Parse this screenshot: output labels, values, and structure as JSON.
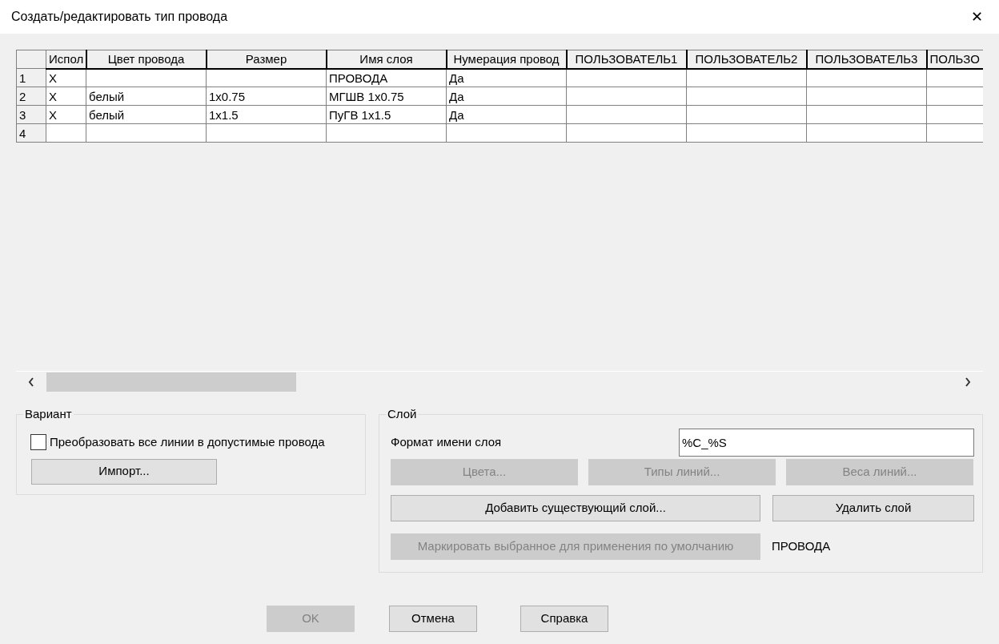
{
  "window": {
    "title": "Создать/редактировать тип провода",
    "close": "✕"
  },
  "table": {
    "columns": [
      "Испол",
      "Цвет провода",
      "Размер",
      "Имя слоя",
      "Нумерация провод",
      "ПОЛЬЗОВАТЕЛЬ1",
      "ПОЛЬЗОВАТЕЛЬ2",
      "ПОЛЬЗОВАТЕЛЬ3",
      "ПОЛЬЗО"
    ],
    "rows": [
      {
        "number": "1",
        "cells": [
          "X",
          "",
          "",
          "ПРОВОДА",
          "Да",
          "",
          "",
          "",
          ""
        ]
      },
      {
        "number": "2",
        "cells": [
          "X",
          "белый",
          "1x0.75",
          "МГШВ 1x0.75",
          "Да",
          "",
          "",
          "",
          ""
        ]
      },
      {
        "number": "3",
        "cells": [
          "X",
          "белый",
          "1x1.5",
          "ПуГВ 1x1.5",
          "Да",
          "",
          "",
          "",
          ""
        ]
      },
      {
        "number": "4",
        "cells": [
          "",
          "",
          "",
          "",
          "",
          "",
          "",
          "",
          ""
        ]
      }
    ]
  },
  "variant": {
    "title": "Вариант",
    "checkbox": {
      "label": "Преобразовать все линии в допустимые провода",
      "checked": false
    },
    "import_button": {
      "label": "Импорт...",
      "disabled": false
    }
  },
  "layer": {
    "title": "Слой",
    "format_label": "Формат имени слоя",
    "format_value": "%C_%S",
    "buttons_row1": [
      {
        "label": "Цвета...",
        "disabled": true
      },
      {
        "label": "Типы линий...",
        "disabled": true
      },
      {
        "label": "Веса линий...",
        "disabled": true
      }
    ],
    "buttons_row2": [
      {
        "label": "Добавить существующий слой...",
        "disabled": false
      },
      {
        "label": "Удалить слой",
        "disabled": false
      }
    ],
    "mark_button": {
      "label": "Маркировать выбранное для применения по умолчанию",
      "disabled": true
    },
    "default_layer": "ПРОВОДА"
  },
  "buttons": [
    {
      "label": "OK",
      "disabled": true
    },
    {
      "label": "Отмена",
      "disabled": false
    },
    {
      "label": "Справка",
      "disabled": false
    }
  ]
}
